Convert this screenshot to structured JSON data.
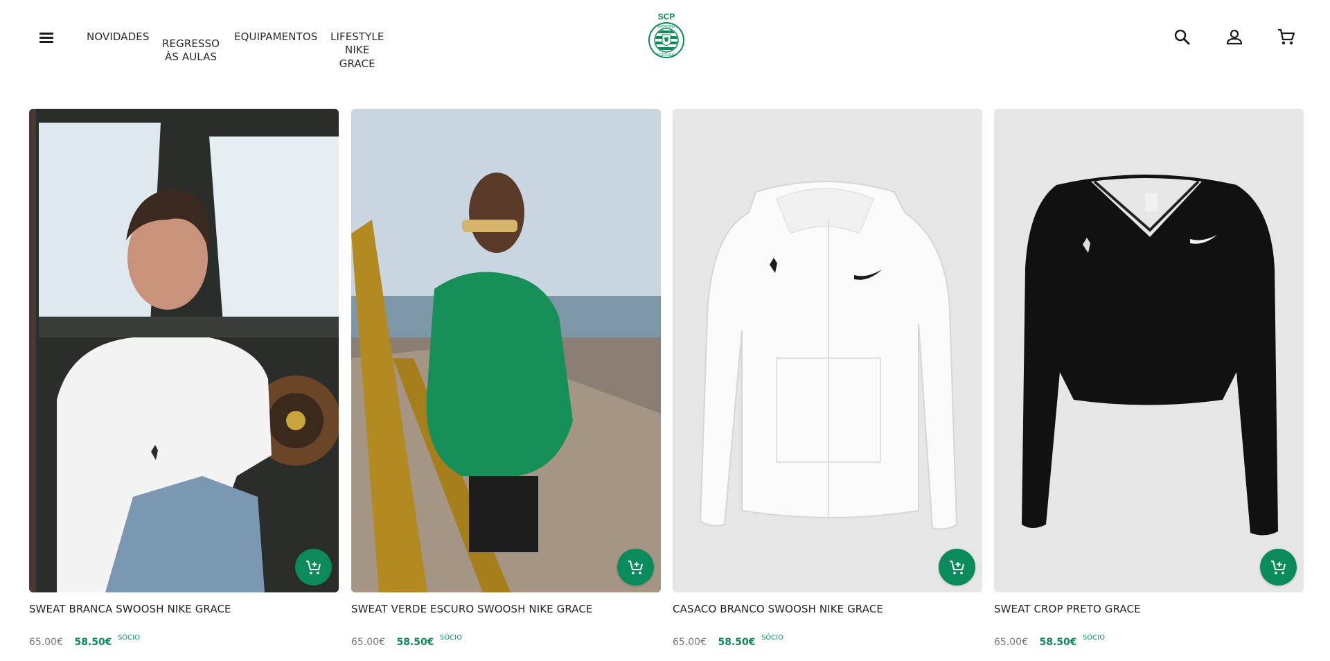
{
  "header": {
    "nav": [
      {
        "label": "NOVIDADES"
      },
      {
        "label": "REGRESSO\nÀS AULAS"
      },
      {
        "label": "EQUIPAMENTOS"
      },
      {
        "label": "LIFESTYLE\nNIKE\nGRACE"
      }
    ],
    "logo_text": {
      "top": "SCP",
      "ring_top": "SPORTING",
      "ring_bottom": "PORTUGAL"
    },
    "icons": [
      "menu-icon",
      "search-icon",
      "account-icon",
      "cart-icon"
    ]
  },
  "products": [
    {
      "name": "SWEAT BRANCA SWOOSH NIKE GRACE",
      "price": "65.00€",
      "member_price": "58.50€",
      "member_label": "SÓCIO"
    },
    {
      "name": "SWEAT VERDE ESCURO SWOOSH NIKE GRACE",
      "price": "65.00€",
      "member_price": "58.50€",
      "member_label": "SÓCIO"
    },
    {
      "name": "CASACO BRANCO SWOOSH NIKE GRACE",
      "price": "65.00€",
      "member_price": "58.50€",
      "member_label": "SÓCIO"
    },
    {
      "name": "SWEAT CROP PRETO GRACE",
      "price": "65.00€",
      "member_price": "58.50€",
      "member_label": "SÓCIO"
    }
  ],
  "colors": {
    "brand_green": "#0b8a5b",
    "text": "#1a1a1a",
    "muted": "#777777"
  }
}
